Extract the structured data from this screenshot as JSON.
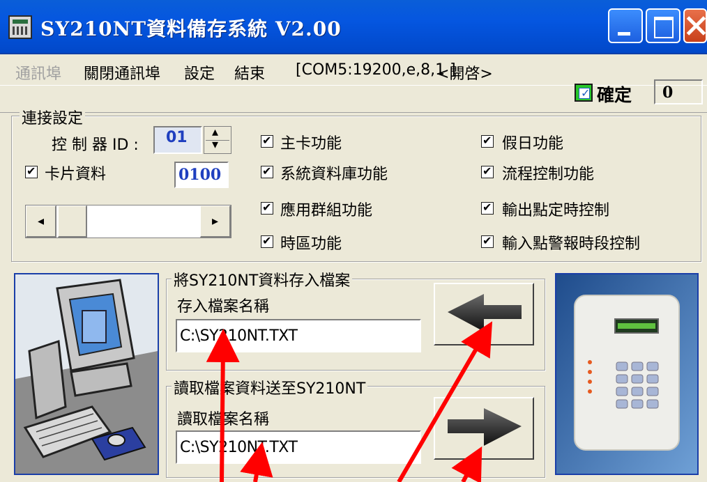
{
  "window": {
    "title": "SY210NT資料備存系統 V2.00"
  },
  "menu": {
    "comm_port": "通訊埠",
    "close_port": "關閉通訊埠",
    "settings": "設定",
    "exit": "結束",
    "port_info": "[COM5:19200,e,8,1 ]",
    "port_state": "<開啓>"
  },
  "status": {
    "ok_label": "確定",
    "count": "0"
  },
  "connection": {
    "group_label": "連接設定",
    "controller_id_label": "控 制 器 ID :",
    "controller_id": "01",
    "card_data_label": "卡片資料",
    "card_count": "0100",
    "features_left": [
      "主卡功能",
      "系統資料庫功能",
      "應用群組功能",
      "時區功能"
    ],
    "features_right": [
      "假日功能",
      "流程控制功能",
      "輸出點定時控制",
      "輸入點警報時段控制"
    ]
  },
  "save": {
    "group_label": "將SY210NT資料存入檔案",
    "filename_label": "存入檔案名稱",
    "filename": "C:\\SY210NT.TXT"
  },
  "load": {
    "group_label": "讀取檔案資料送至SY210NT",
    "filename_label": "讀取檔案名稱",
    "filename": "C:\\SY210NT.TXT"
  },
  "colors": {
    "titlebar": "#0556e0",
    "annotation_arrow": "#ff0000",
    "text_blue": "#1f3fbf"
  }
}
